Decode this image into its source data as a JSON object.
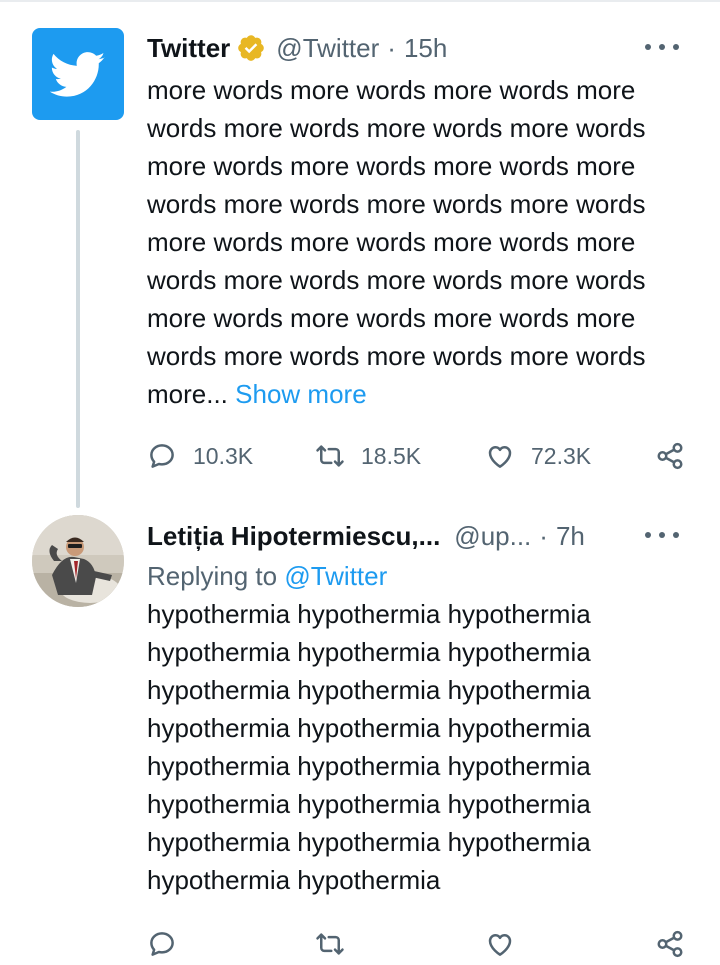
{
  "tweet": {
    "author": {
      "name": "Twitter",
      "handle": "@Twitter",
      "separator": "·",
      "time": "15h"
    },
    "text": "more words more words more words more words more words more words more words more words more words more words more words more words more words more words more words more words more words more words more words more words more words more words more words more words more words more words more words more words more...",
    "show_more_label": "Show more",
    "stats": {
      "replies": "10.3K",
      "retweets": "18.5K",
      "likes": "72.3K"
    }
  },
  "reply": {
    "author": {
      "name": "Letiția Hipotermiescu,...",
      "handle": "@up...",
      "separator": "·",
      "time": "7h"
    },
    "replying_prefix": "Replying to",
    "replying_to": "@Twitter",
    "text": "hypothermia hypothermia hypothermia hypothermia hypothermia hypothermia hypothermia hypothermia hypothermia hypothermia hypothermia hypothermia hypothermia hypothermia hypothermia hypothermia hypothermia hypothermia hypothermia hypothermia hypothermia hypothermia hypothermia"
  },
  "colors": {
    "accent": "#1d9bf0",
    "text": "#0f1419",
    "muted": "#536471",
    "verified": "#e8b724"
  },
  "icons": [
    "twitter-bird-icon",
    "verified-badge-icon",
    "more-icon",
    "reply-icon",
    "retweet-icon",
    "like-icon",
    "share-icon"
  ]
}
